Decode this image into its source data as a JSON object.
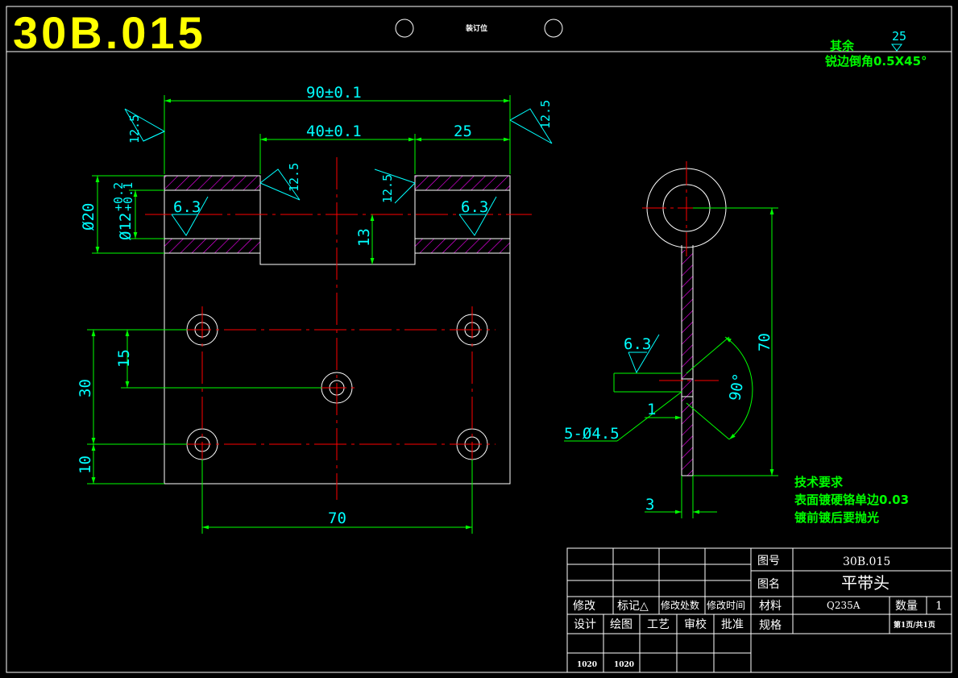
{
  "header": {
    "drawing_number_large": "30B.015",
    "binding_label": "装订位"
  },
  "notes_top": {
    "rest_label": "其余",
    "rest_roughness": "25",
    "chamfer_note": "锐边倒角0.5X45°"
  },
  "dimensions": {
    "overall_width": "90±0.1",
    "slot_width": "40±0.1",
    "right_width": "25",
    "roughness_12_5": "12.5",
    "roughness_6_3": "6.3",
    "dia_outer": "Ø20",
    "dia_inner_base": "Ø12",
    "dia_inner_tol_upper": "+0.2",
    "dia_inner_tol_lower": "+0.1",
    "slot_depth": "13",
    "hole_pitch_15": "15",
    "hole_pitch_30": "30",
    "edge_10": "10",
    "hole_span_70": "70",
    "side_height_70": "70",
    "angle_90": "90°",
    "offset_1": "1",
    "holes_spec": "5-Ø4.5",
    "thickness_3": "3"
  },
  "tech_requirements": {
    "title": "技术要求",
    "line1": "表面镀硬铬单边0.03",
    "line2": "镀前镀后要抛光"
  },
  "title_block": {
    "drawing_no_label": "图号",
    "drawing_no_value": "30B.015",
    "name_label": "图名",
    "name_value": "平带头",
    "material_label": "材料",
    "material_value": "Q235A",
    "qty_label": "数量",
    "qty_value": "1",
    "spec_label": "规格",
    "page_info": "第1页/共1页",
    "col_modify": "修改",
    "col_mark": "标记△",
    "col_place": "修改处数",
    "col_time": "修改时间",
    "col_design": "设计",
    "col_draw": "绘图",
    "col_process": "工艺",
    "col_check": "审校",
    "col_approve": "批准",
    "design_code": "1020",
    "draw_code": "1020"
  },
  "colors": {
    "background": "#000000",
    "outline": "#ffffff",
    "dimension": "#00ff00",
    "dimension_text": "#00ffff",
    "centerline": "#ff0000",
    "hatch": "#ff00ff",
    "title": "#ffff00"
  }
}
